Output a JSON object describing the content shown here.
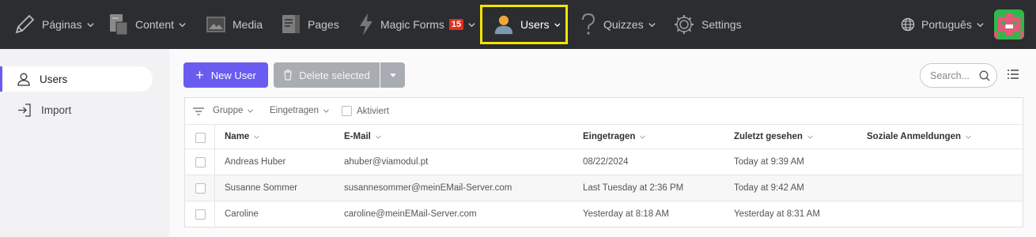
{
  "nav": {
    "items": [
      {
        "label": "Páginas",
        "icon": "pencil-icon"
      },
      {
        "label": "Content",
        "icon": "content-icon"
      },
      {
        "label": "Media",
        "icon": "media-icon"
      },
      {
        "label": "Pages",
        "icon": "pages-icon"
      },
      {
        "label": "Magic Forms",
        "icon": "lightning-icon",
        "badge": "15"
      },
      {
        "label": "Users",
        "icon": "user-icon"
      },
      {
        "label": "Quizzes",
        "icon": "question-icon"
      },
      {
        "label": "Settings",
        "icon": "gear-icon"
      }
    ],
    "language": "Português",
    "colors": {
      "bg": "#2b2d30",
      "active_outline": "#f5e400",
      "badge": "#e0301e"
    }
  },
  "sidebar": {
    "items": [
      {
        "label": "Users",
        "icon": "user-outline-icon",
        "active": true
      },
      {
        "label": "Import",
        "icon": "import-icon",
        "active": false
      }
    ]
  },
  "toolbar": {
    "new_user": "New User",
    "delete_selected": "Delete selected",
    "search_placeholder": "Search...",
    "accent": "#6a5cf0"
  },
  "filters": {
    "gruppe": "Gruppe",
    "eingetragen": "Eingetragen",
    "aktiviert": "Aktiviert"
  },
  "table": {
    "columns": [
      "Name",
      "E-Mail",
      "Eingetragen",
      "Zuletzt gesehen",
      "Soziale Anmeldungen"
    ],
    "rows": [
      {
        "name": "Andreas Huber",
        "email": "ahuber@viamodul.pt",
        "registered": "08/22/2024",
        "last_seen": "Today at 9:39 AM"
      },
      {
        "name": "Susanne Sommer",
        "email": "susannesommer@meinEMail-Server.com",
        "registered": "Last Tuesday at 2:36 PM",
        "last_seen": "Today at 9:42 AM"
      },
      {
        "name": "Caroline",
        "email": "caroline@meinEMail-Server.com",
        "registered": "Yesterday at 8:18 AM",
        "last_seen": "Yesterday at 8:31 AM"
      }
    ]
  }
}
